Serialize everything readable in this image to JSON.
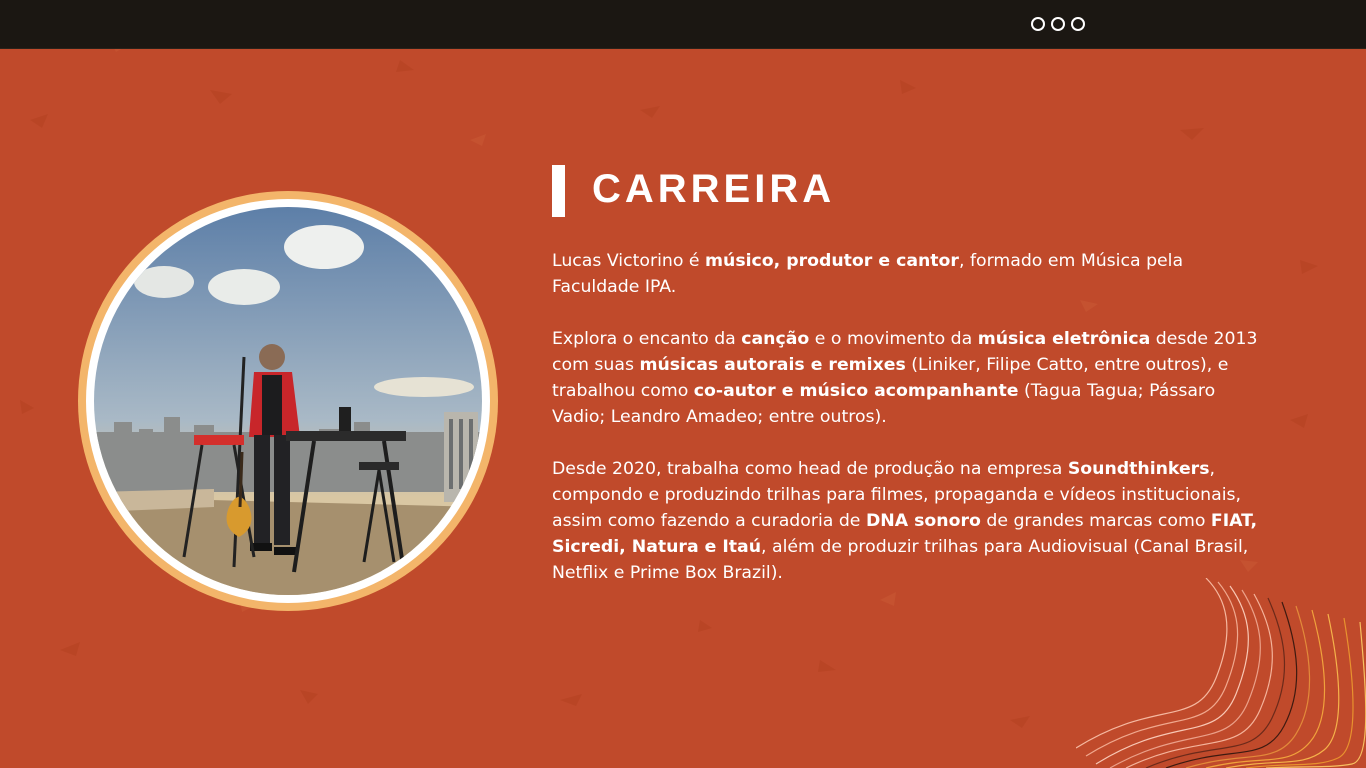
{
  "slide": {
    "title": "CARREIRA",
    "photo_alt": "Lucas Victorino tocando em um terraço com vista da cidade"
  },
  "paragraph1": {
    "t1": "Lucas Victorino é ",
    "b1": "músico, produtor e cantor",
    "t2": ", formado em Música pela Faculdade IPA."
  },
  "paragraph2": {
    "t1": "Explora o encanto da ",
    "b1": "canção",
    "t2": " e o movimento da ",
    "b2": "música eletrônica",
    "t3": " desde 2013 com suas ",
    "b3": "músicas autorais e remixes",
    "t4": " (Liniker, Filipe Catto, entre outros), e trabalhou como ",
    "b4": "co-autor e músico acompanhante",
    "t5": " (Tagua Tagua; Pássaro Vadio; Leandro Amadeo; entre outros)."
  },
  "paragraph3": {
    "t1": "Desde 2020, trabalha como head de produção na empresa ",
    "b1": "Soundthinkers",
    "t2": ", compondo e produzindo trilhas para filmes, propaganda e vídeos institucionais, assim como fazendo a curadoria de ",
    "b2": "DNA sonoro",
    "t3": " de grandes marcas como ",
    "b3": "FIAT, Sicredi, Natura e Itaú",
    "t4": ", além de produzir trilhas para Audiovisual (Canal Brasil, Netflix e Prime Box Brazil)."
  },
  "colors": {
    "background": "#c04a2b",
    "topbar": "#1b1712",
    "frame_outer": "#f3b56a",
    "text": "#ffffff"
  }
}
